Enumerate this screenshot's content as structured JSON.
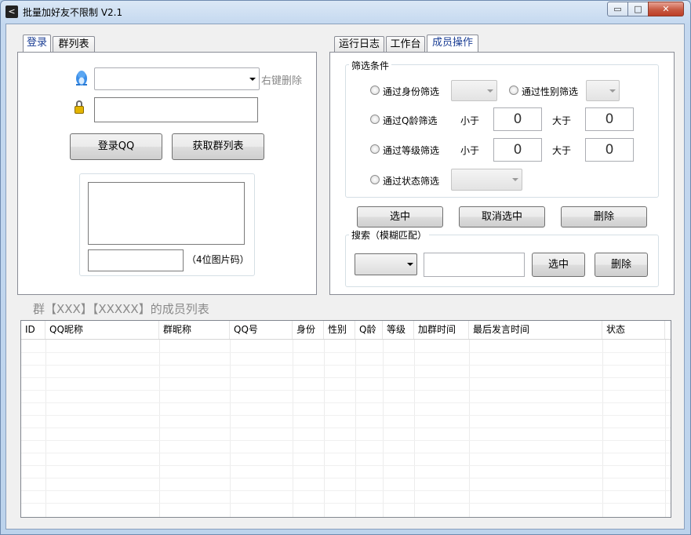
{
  "window": {
    "title": "批量加好友不限制 V2.1",
    "min_glyph": "▭",
    "max_glyph": "□",
    "close_glyph": "✕"
  },
  "left_panel": {
    "tabs": [
      "登录",
      "群列表"
    ],
    "active_tab": "登录",
    "qq_combo_value": "",
    "right_click_delete": "右键删除",
    "password_value": "",
    "login_button": "登录QQ",
    "get_groups_button": "获取群列表",
    "captcha_input_value": "",
    "captcha_hint": "（4位图片码）"
  },
  "right_panel": {
    "tabs": [
      "运行日志",
      "工作台",
      "成员操作"
    ],
    "active_tab": "成员操作",
    "filter_group_title": "筛选条件",
    "filters": {
      "identity": "通过身份筛选",
      "gender": "通过性别筛选",
      "age": "通过Q龄筛选",
      "level": "通过等级筛选",
      "status": "通过状态筛选",
      "less_than": "小于",
      "greater_than": "大于",
      "age_min": "0",
      "age_max": "0",
      "level_min": "0",
      "level_max": "0"
    },
    "buttons": {
      "select": "选中",
      "deselect": "取消选中",
      "delete": "删除"
    },
    "search_group_title": "搜索（模糊匹配）",
    "search_value": "",
    "search_select_button": "选中",
    "search_delete_button": "删除"
  },
  "member_list": {
    "heading": "群【XXX】【XXXXX】的成员列表",
    "columns": [
      "ID",
      "QQ昵称",
      "群昵称",
      "QQ号",
      "身份",
      "性别",
      "Q龄",
      "等级",
      "加群时间",
      "最后发言时间",
      "状态"
    ],
    "rows": []
  },
  "colors": {
    "active_tab_text": "#1c3f95",
    "window_frame": "#bcd3ec",
    "close_button": "#c75a43"
  },
  "icons": {
    "app": "back-arrow-icon",
    "qq_user": "qq-penguin-icon",
    "password": "lock-icon"
  }
}
